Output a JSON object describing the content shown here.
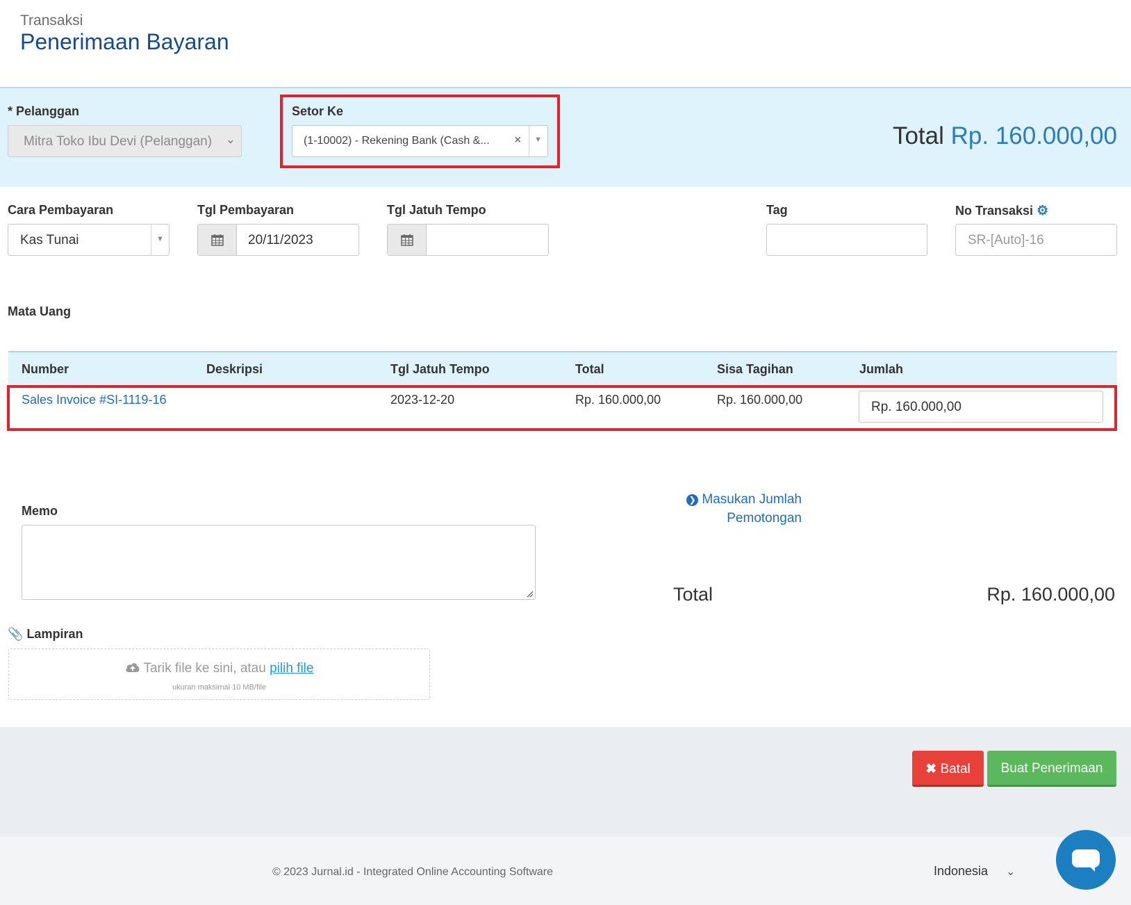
{
  "header": {
    "breadcrumb": "Transaksi",
    "title": "Penerimaan Bayaran"
  },
  "customer": {
    "label": "* Pelanggan",
    "value": "Mitra Toko Ibu Devi (Pelanggan)"
  },
  "deposit_to": {
    "label": "Setor Ke",
    "value": "(1-10002) - Rekening Bank (Cash &..."
  },
  "summary_total": {
    "label": "Total",
    "amount": "Rp. 160.000,00"
  },
  "form": {
    "payment_method": {
      "label": "Cara Pembayaran",
      "value": "Kas Tunai"
    },
    "payment_date": {
      "label": "Tgl Pembayaran",
      "value": "20/11/2023"
    },
    "due_date": {
      "label": "Tgl Jatuh Tempo",
      "value": ""
    },
    "tag": {
      "label": "Tag",
      "value": ""
    },
    "transaction_no": {
      "label": "No Transaksi",
      "placeholder": "SR-[Auto]-16"
    },
    "currency_label": "Mata Uang"
  },
  "table": {
    "headers": [
      "Number",
      "Deskripsi",
      "Tgl Jatuh Tempo",
      "Total",
      "Sisa Tagihan",
      "Jumlah"
    ],
    "rows": [
      {
        "number": "Sales Invoice #SI-1119-16",
        "description": "",
        "due_date": "2023-12-20",
        "total": "Rp. 160.000,00",
        "remaining": "Rp. 160.000,00",
        "amount": "Rp. 160.000,00"
      }
    ]
  },
  "memo": {
    "label": "Memo",
    "value": ""
  },
  "deduction_link": {
    "line1": "Masukan Jumlah",
    "line2": "Pemotongan"
  },
  "bottom_total": {
    "label": "Total",
    "amount": "Rp. 160.000,00"
  },
  "attachment": {
    "label": "Lampiran",
    "drop_text": "Tarik file ke sini, atau",
    "pick_link": "pilih file",
    "size_note": "ukuran maksimal 10 MB/file"
  },
  "actions": {
    "cancel": "Batal",
    "submit": "Buat Penerimaan"
  },
  "footer": {
    "copyright": "© 2023 Jurnal.id - Integrated Online Accounting Software",
    "language": "Indonesia"
  },
  "colors": {
    "title": "#164a8a",
    "band": "#def3fb",
    "link": "#1f6eb7",
    "highlight": "#e3222b",
    "cancel": "#e8413a",
    "submit": "#5cb85c",
    "chat": "#1b7fc1"
  }
}
